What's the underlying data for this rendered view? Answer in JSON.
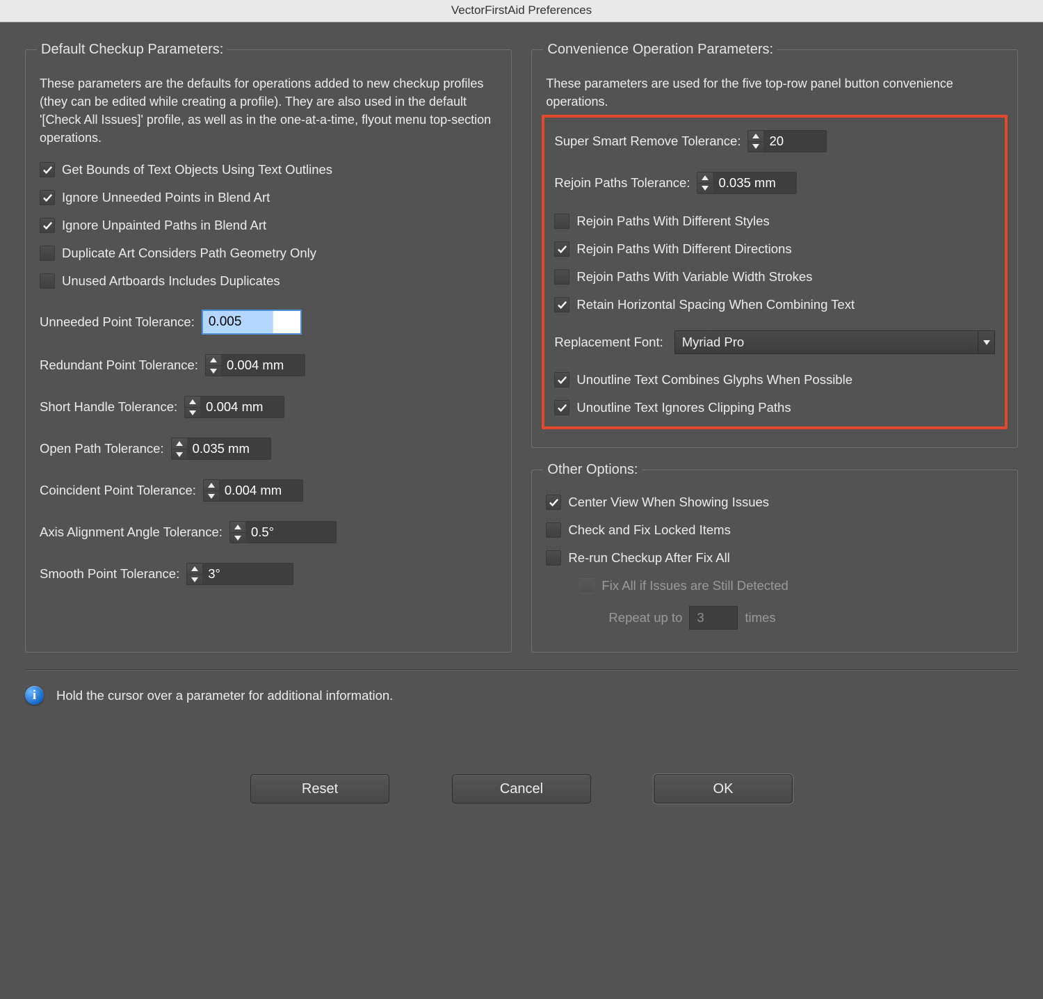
{
  "window": {
    "title": "VectorFirstAid Preferences"
  },
  "left": {
    "legend": "Default Checkup Parameters:",
    "desc": "These parameters are the defaults for operations added to new checkup profiles (they can be edited while creating a profile). They are also used in the default '[Check All Issues]' profile, as well as in the one-at-a-time, flyout menu top-section operations.",
    "cb1": "Get Bounds of Text Objects Using Text Outlines",
    "cb2": "Ignore Unneeded Points in Blend Art",
    "cb3": "Ignore Unpainted Paths in Blend Art",
    "cb4": "Duplicate Art Considers Path Geometry Only",
    "cb5": "Unused Artboards Includes Duplicates",
    "unneeded_label": "Unneeded Point Tolerance:",
    "unneeded_value": "0.005",
    "redundant_label": "Redundant Point Tolerance:",
    "redundant_value": "0.004 mm",
    "shorthandle_label": "Short Handle Tolerance:",
    "shorthandle_value": "0.004 mm",
    "openpath_label": "Open Path Tolerance:",
    "openpath_value": "0.035 mm",
    "coincident_label": "Coincident Point Tolerance:",
    "coincident_value": "0.004 mm",
    "axis_label": "Axis Alignment Angle Tolerance:",
    "axis_value": "0.5°",
    "smooth_label": "Smooth Point Tolerance:",
    "smooth_value": "3°"
  },
  "right": {
    "legend": "Convenience Operation Parameters:",
    "desc": "These parameters are used for the five top-row panel button convenience operations.",
    "ssr_label": "Super Smart Remove Tolerance:",
    "ssr_value": "20",
    "rejoin_label": "Rejoin Paths Tolerance:",
    "rejoin_value": "0.035 mm",
    "r1": "Rejoin Paths With Different Styles",
    "r2": "Rejoin Paths With Different Directions",
    "r3": "Rejoin Paths With Variable Width Strokes",
    "r4": "Retain Horizontal Spacing When Combining Text",
    "font_label": "Replacement Font:",
    "font_value": "Myriad Pro",
    "u1": "Unoutline Text Combines Glyphs When Possible",
    "u2": "Unoutline Text Ignores Clipping Paths"
  },
  "other": {
    "legend": "Other Options:",
    "o1": "Center View When Showing Issues",
    "o2": "Check and Fix Locked Items",
    "o3": "Re-run Checkup After Fix All",
    "o4": "Fix All if Issues are Still Detected",
    "repeat_pre": "Repeat up to",
    "repeat_val": "3",
    "repeat_post": "times"
  },
  "footer": {
    "info": "Hold the cursor over a parameter for additional information.",
    "reset": "Reset",
    "cancel": "Cancel",
    "ok": "OK"
  }
}
